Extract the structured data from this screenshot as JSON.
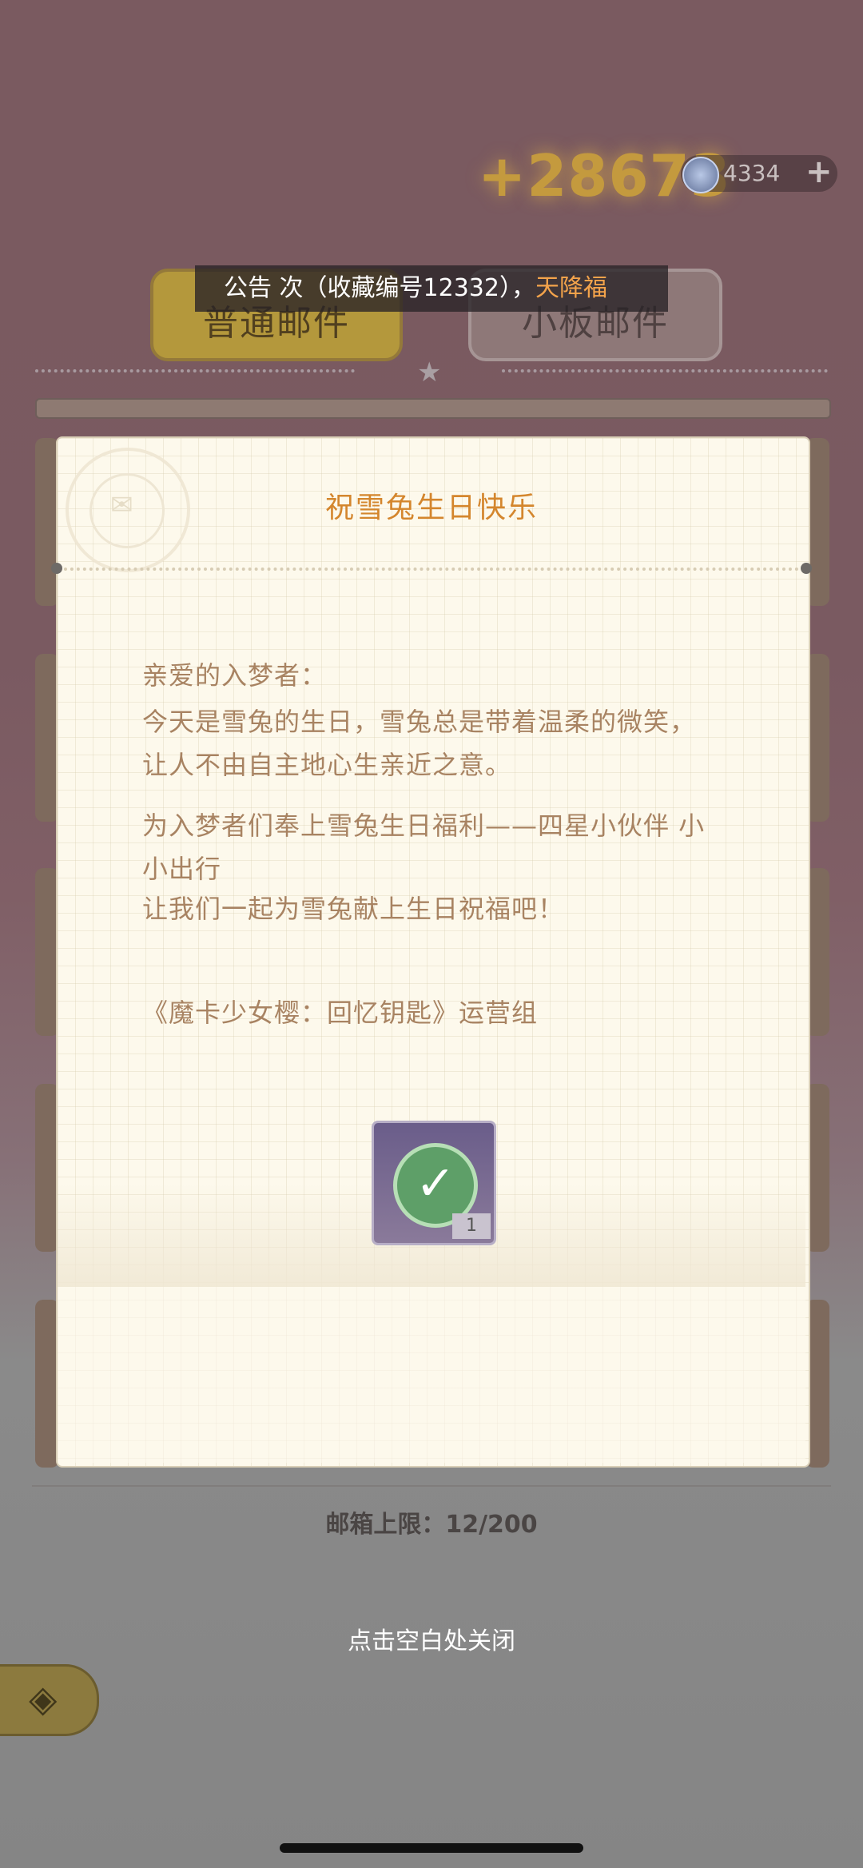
{
  "header": {
    "bonus_text": "+28673",
    "currency_value": "4334",
    "currency_plus": "+",
    "currency_icon": "crystal-icon"
  },
  "tabs": [
    {
      "label": "普通邮件",
      "active": true
    },
    {
      "label": "小板邮件",
      "active": false
    }
  ],
  "announcement": {
    "prefix": "公告",
    "body": "次（收藏编号12332），",
    "highlight": "天降福"
  },
  "letter": {
    "title": "祝雪兔生日快乐",
    "greeting": "亲爱的入梦者：",
    "paragraph1": "今天是雪兔的生日，雪兔总是带着温柔的微笑，让人不由自主地心生亲近之意。",
    "paragraph2": "为入梦者们奉上雪兔生日福利——四星小伙伴 小小出行",
    "paragraph3": "让我们一起为雪兔献上生日祝福吧！",
    "signature": "《魔卡少女樱：回忆钥匙》运营组",
    "reward": {
      "icon": "check-icon",
      "count": "1",
      "claimed": true
    }
  },
  "footer": {
    "mailbox_limit": "邮箱上限：12/200",
    "close_tip": "点击空白处关闭",
    "back_icon": "back-icon"
  },
  "colors": {
    "title_orange": "#d4862d",
    "body_brown": "#a88362",
    "highlight": "#f3a34b"
  }
}
